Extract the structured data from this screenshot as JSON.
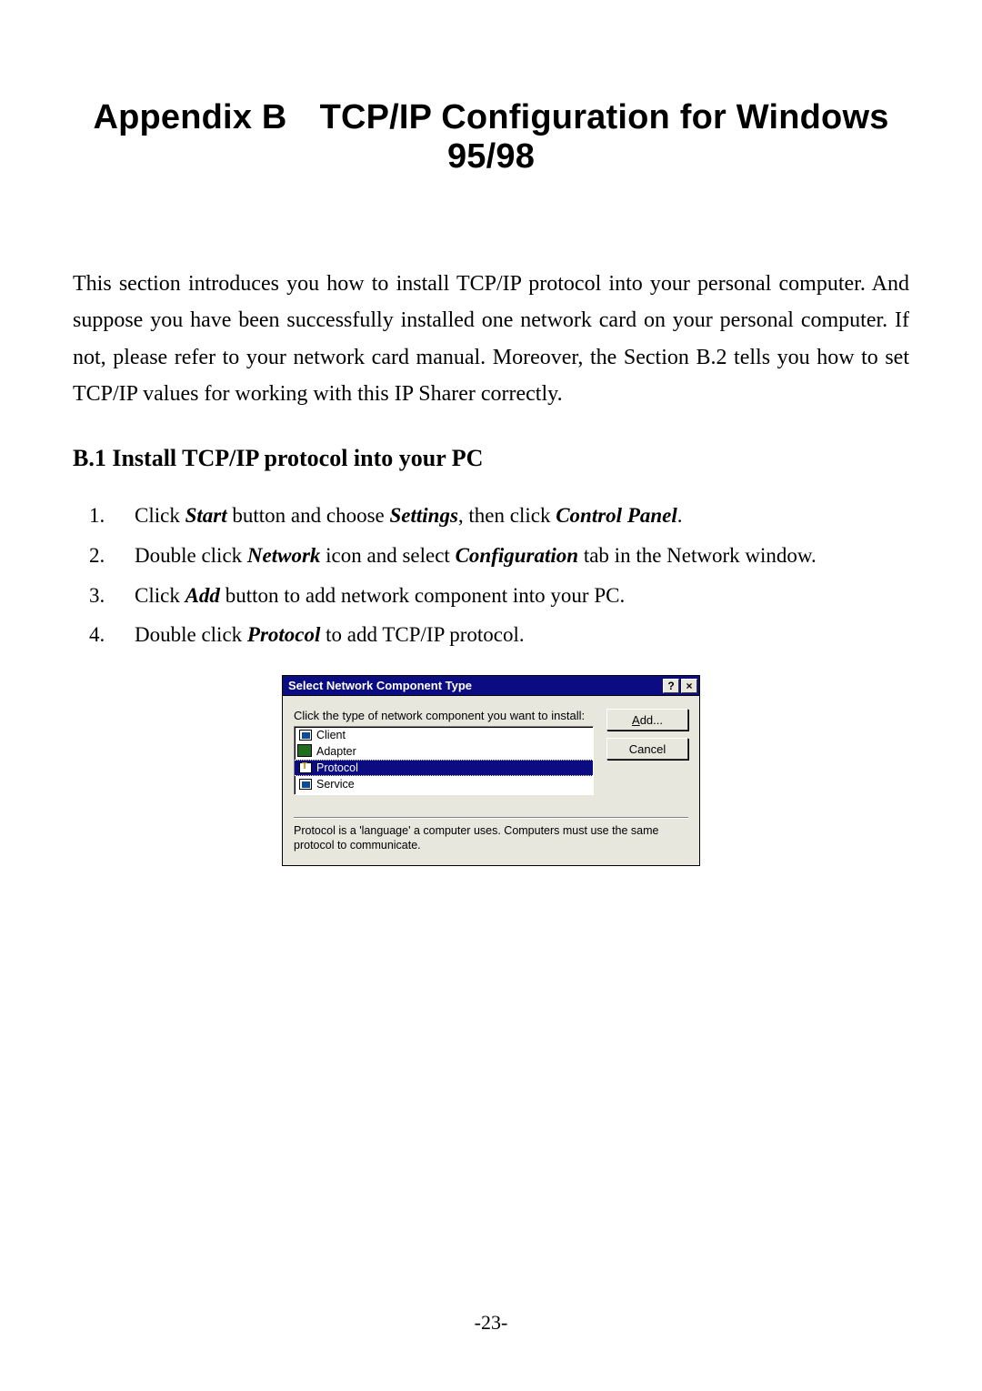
{
  "title_a": "Appendix B",
  "title_b": "TCP/IP Configuration for Windows 95/98",
  "intro": "This section introduces you how to install TCP/IP protocol into your personal computer. And suppose you have been successfully installed one network card on your personal computer. If not, please refer to your network card manual. Moreover, the Section B.2 tells you how to set TCP/IP values for working with this IP Sharer correctly.",
  "h2": "B.1 Install TCP/IP protocol into your PC",
  "steps": {
    "s1": {
      "num": "1.",
      "a": "Click ",
      "b": "Start",
      "c": " button and choose ",
      "d": "Settings",
      "e": ", then click ",
      "f": "Control Panel",
      "g": "."
    },
    "s2": {
      "num": "2.",
      "a": "Double click ",
      "b": "Network",
      "c": " icon and select ",
      "d": "Configuration",
      "e": " tab in the Network window."
    },
    "s3": {
      "num": "3.",
      "a": "Click ",
      "b": "Add",
      "c": " button to add network component into your PC."
    },
    "s4": {
      "num": "4.",
      "a": "Double click ",
      "b": "Protocol",
      "c": " to add TCP/IP protocol."
    }
  },
  "dialog": {
    "title": "Select Network Component Type",
    "help": "?",
    "close": "×",
    "instruction": "Click the type of network component you want to install:",
    "items": {
      "client": "Client",
      "adapter": "Adapter",
      "protocol": "Protocol",
      "service": "Service"
    },
    "buttons": {
      "add_u": "A",
      "add_rest": "dd...",
      "cancel": "Cancel"
    },
    "description": "Protocol is a 'language' a computer uses. Computers must use the same protocol to communicate."
  },
  "page_number": "-23-"
}
